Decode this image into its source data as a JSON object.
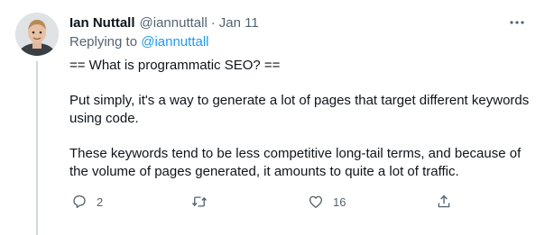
{
  "tweet": {
    "author_name": "Ian Nuttall",
    "author_handle": "@iannuttall",
    "separator": "·",
    "date": "Jan 11",
    "replying_prefix": "Replying to",
    "replying_to": "@iannuttall",
    "paragraphs": [
      "== What is programmatic SEO? ==",
      "Put simply, it's a way to generate a lot of pages that target different keywords using code.",
      "These keywords tend to be less competitive long-tail terms, and because of the volume of pages generated, it amounts to quite a lot of traffic."
    ],
    "actions": {
      "reply": {
        "icon": "reply-icon",
        "count": "2"
      },
      "retweet": {
        "icon": "retweet-icon",
        "count": ""
      },
      "like": {
        "icon": "heart-icon",
        "count": "16"
      },
      "share": {
        "icon": "share-icon",
        "count": ""
      }
    }
  },
  "colors": {
    "text_primary": "#0f1419",
    "text_secondary": "#536471",
    "link": "#1d9bf0",
    "thread_line": "#cfd9de"
  }
}
